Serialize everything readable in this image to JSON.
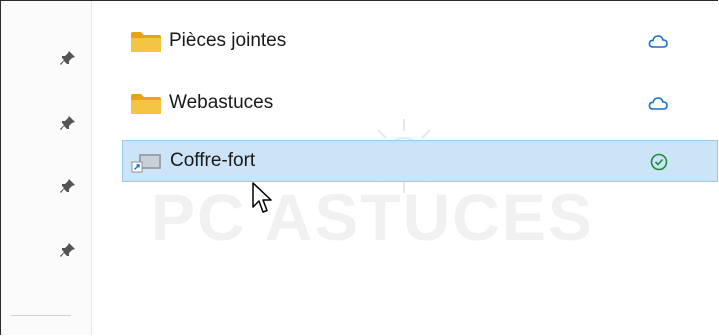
{
  "nav_pane": {
    "pins": [
      "pin-icon",
      "pin-icon",
      "pin-icon",
      "pin-icon"
    ]
  },
  "files": [
    {
      "name": "Pièces jointes",
      "icon": "folder-icon",
      "status": "cloud-icon",
      "selected": false
    },
    {
      "name": "Webastuces",
      "icon": "folder-icon",
      "status": "cloud-icon",
      "selected": false
    },
    {
      "name": "Coffre-fort",
      "icon": "shortcut-icon",
      "status": "synced-check-icon",
      "selected": true
    }
  ],
  "watermark": {
    "text": "PC ASTUCES"
  },
  "colors": {
    "folder_yellow": "#f4c542",
    "selection_bg": "#cce4f7",
    "selection_border": "#99c9ef",
    "cloud_blue": "#1a6fc9",
    "check_green": "#1f8a3b"
  }
}
